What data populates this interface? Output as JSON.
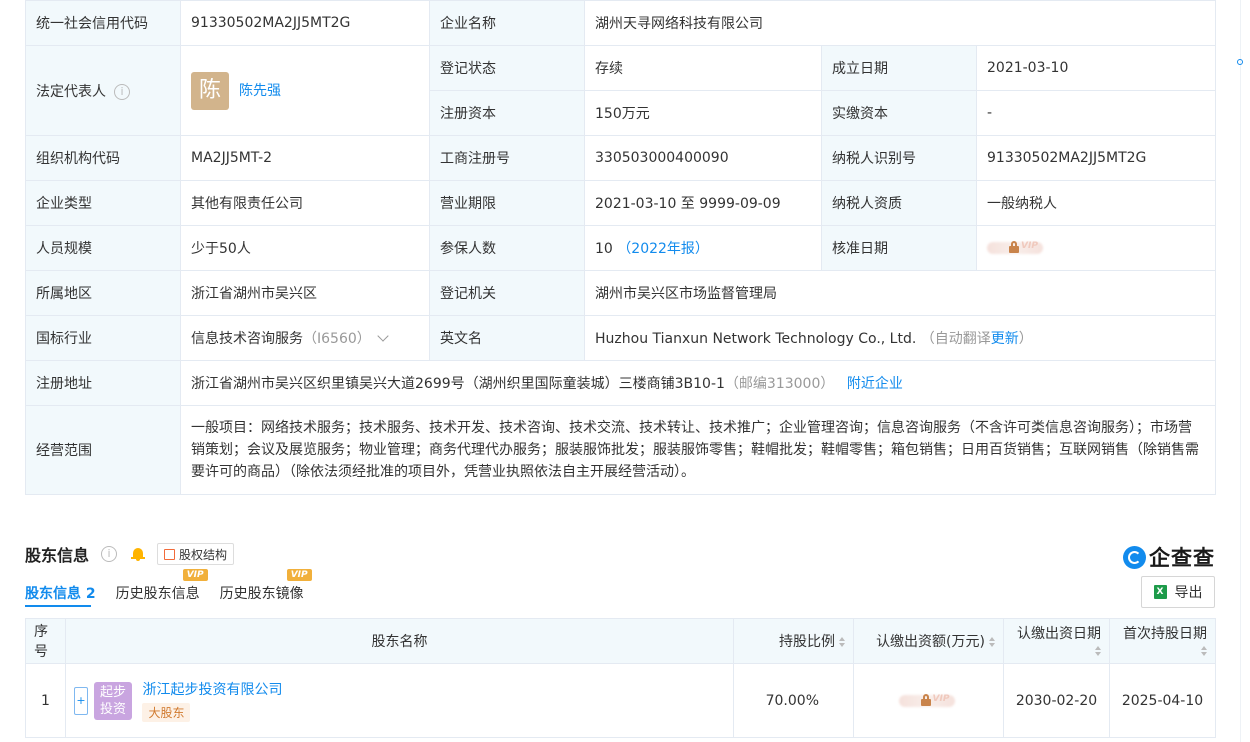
{
  "info": {
    "credit_code_label": "统一社会信用代码",
    "credit_code": "91330502MA2JJ5MT2G",
    "company_name_label": "企业名称",
    "company_name": "湖州天寻网络科技有限公司",
    "legal_rep_label": "法定代表人",
    "legal_rep_avatar": "陈",
    "legal_rep_name": "陈先强",
    "reg_status_label": "登记状态",
    "reg_status": "存续",
    "founded_label": "成立日期",
    "founded": "2021-03-10",
    "reg_capital_label": "注册资本",
    "reg_capital": "150万元",
    "paid_capital_label": "实缴资本",
    "paid_capital": "-",
    "org_code_label": "组织机构代码",
    "org_code": "MA2JJ5MT-2",
    "biz_reg_no_label": "工商注册号",
    "biz_reg_no": "330503000400090",
    "taxpayer_id_label": "纳税人识别号",
    "taxpayer_id": "91330502MA2JJ5MT2G",
    "company_type_label": "企业类型",
    "company_type": "其他有限责任公司",
    "biz_term_label": "营业期限",
    "biz_term": "2021-03-10 至 9999-09-09",
    "taxpayer_qual_label": "纳税人资质",
    "taxpayer_qual": "一般纳税人",
    "staff_size_label": "人员规模",
    "staff_size": "少于50人",
    "insured_label": "参保人数",
    "insured": "10",
    "insured_report": "（2022年报）",
    "approval_date_label": "核准日期",
    "approval_vip": "VIP",
    "region_label": "所属地区",
    "region": "浙江省湖州市吴兴区",
    "reg_authority_label": "登记机关",
    "reg_authority": "湖州市吴兴区市场监督管理局",
    "industry_label": "国标行业",
    "industry": "信息技术咨询服务",
    "industry_code": "（I6560）",
    "english_name_label": "英文名",
    "english_name": "Huzhou Tianxun Network Technology Co., Ltd.",
    "auto_translate": "（自动翻译",
    "update_link": "更新",
    "auto_translate_end": "）",
    "address_label": "注册地址",
    "address": "浙江省湖州市吴兴区织里镇吴兴大道2699号（湖州织里国际童装城）三楼商铺3B10-1",
    "postcode": "（邮编313000）",
    "nearby_link": "附近企业",
    "scope_label": "经营范围",
    "scope": "一般项目：网络技术服务；技术服务、技术开发、技术咨询、技术交流、技术转让、技术推广；企业管理咨询；信息咨询服务（不含许可类信息咨询服务）；市场营销策划；会议及展览服务；物业管理；商务代理代办服务；服装服饰批发；服装服饰零售；鞋帽批发；鞋帽零售；箱包销售；日用百货销售；互联网销售（除销售需要许可的商品）（除依法须经批准的项目外，凭营业执照依法自主开展经营活动）。"
  },
  "shareholders": {
    "title": "股东信息",
    "structure_button": "股权结构",
    "brand": "企查查",
    "tabs": [
      {
        "label": "股东信息",
        "count": "2"
      },
      {
        "label": "历史股东信息",
        "badge": "VIP"
      },
      {
        "label": "历史股东镜像",
        "badge": "VIP"
      }
    ],
    "export_label": "导出",
    "columns": [
      "序号",
      "股东名称",
      "持股比例",
      "认缴出资额(万元)",
      "认缴出资日期",
      "首次持股日期"
    ],
    "rows": [
      {
        "index": "1",
        "logo_text": "起步投资",
        "name": "浙江起步投资有限公司",
        "tag": "大股东",
        "ratio": "70.00%",
        "amount_vip": "VIP",
        "subscribe_date": "2030-02-20",
        "first_date": "2025-04-10"
      }
    ]
  }
}
